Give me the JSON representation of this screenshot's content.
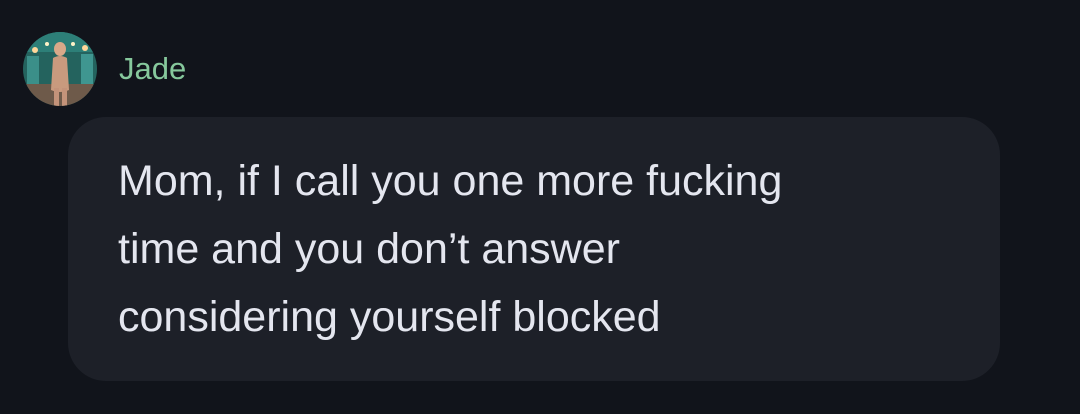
{
  "message": {
    "sender": {
      "name": "Jade",
      "name_color": "#86c89c",
      "avatar_icon": "profile-photo"
    },
    "text": "Mom, if I call you one more fucking\ntime and you don’t answer\nconsidering yourself blocked",
    "bubble_color": "#1d2028",
    "text_color": "#e4e6ef"
  },
  "background_color": "#11141b"
}
